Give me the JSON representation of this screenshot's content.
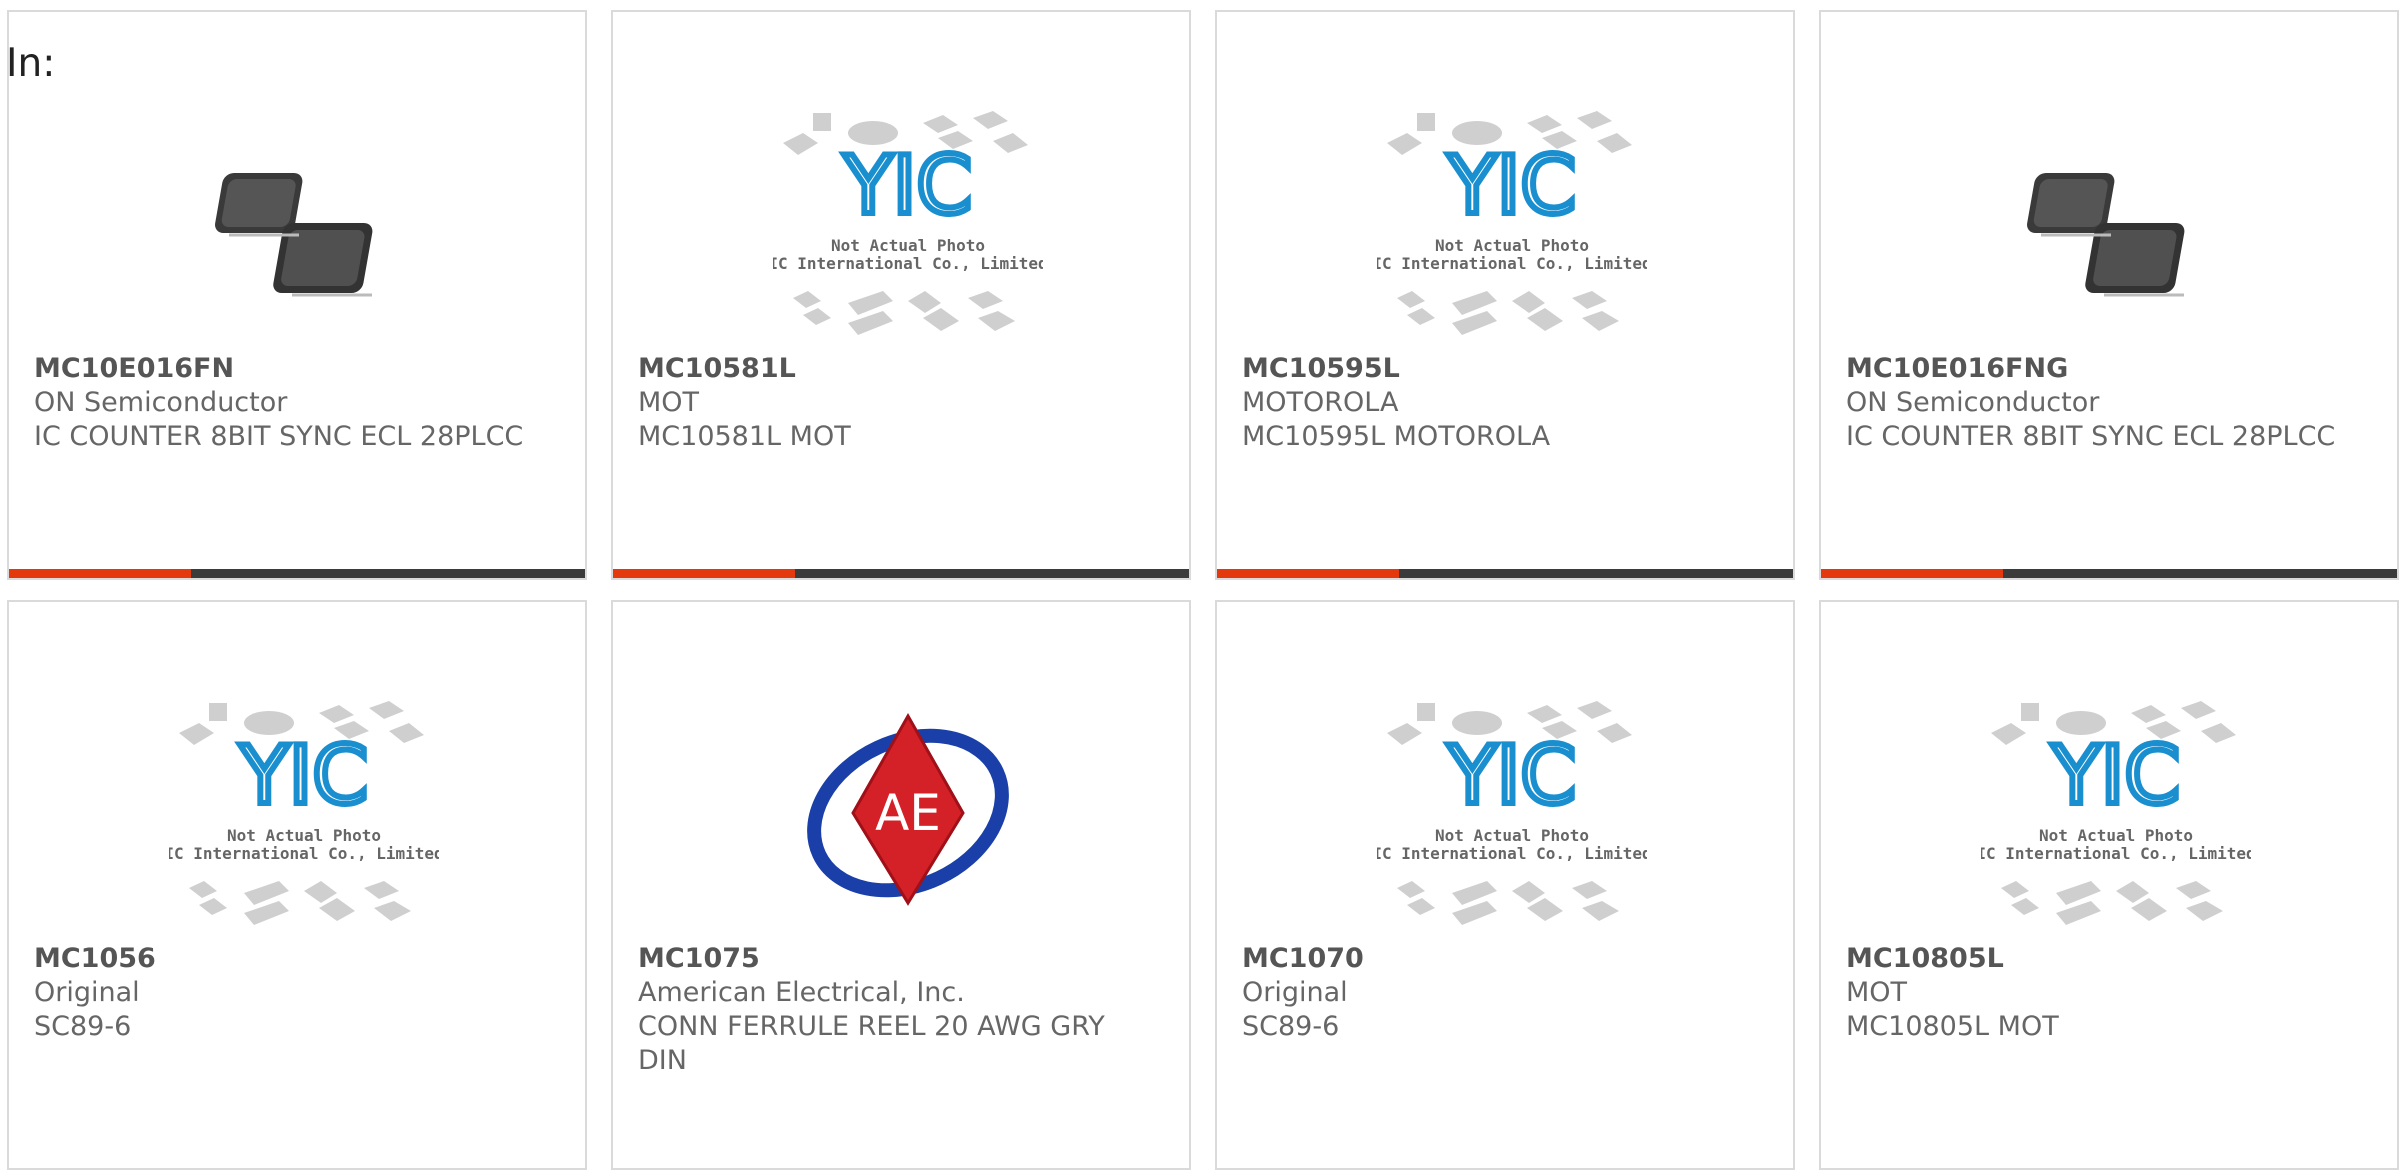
{
  "heading": "In:",
  "colors": {
    "accent": "#e4380d",
    "bar_dark": "#3b3b3b",
    "card_border": "#dadada",
    "text": "#666666",
    "yic_blue": "#1a8fd0"
  },
  "placeholder_caption": {
    "line1": "Not Actual Photo",
    "line2": "YIC International Co., Limited."
  },
  "products": [
    {
      "part": "MC10E016FN",
      "manufacturer": "ON Semiconductor",
      "description": "IC COUNTER 8BIT SYNC ECL 28PLCC",
      "image": "plcc-chip-photo"
    },
    {
      "part": "MC10581L",
      "manufacturer": "MOT",
      "description": "MC10581L MOT",
      "image": "yic-placeholder"
    },
    {
      "part": "MC10595L",
      "manufacturer": "MOTOROLA",
      "description": "MC10595L MOTOROLA",
      "image": "yic-placeholder"
    },
    {
      "part": "MC10E016FNG",
      "manufacturer": "ON Semiconductor",
      "description": "IC COUNTER 8BIT SYNC ECL 28PLCC",
      "image": "plcc-chip-photo"
    },
    {
      "part": "MC1056",
      "manufacturer": "Original",
      "description": "SC89-6",
      "image": "yic-placeholder"
    },
    {
      "part": "MC1075",
      "manufacturer": "American Electrical, Inc.",
      "description": "CONN FERRULE REEL 20 AWG GRY DIN",
      "image": "ae-logo",
      "logo_text": "AE"
    },
    {
      "part": "MC1070",
      "manufacturer": "Original",
      "description": "SC89-6",
      "image": "yic-placeholder"
    },
    {
      "part": "MC10805L",
      "manufacturer": "MOT",
      "description": "MC10805L MOT",
      "image": "yic-placeholder"
    }
  ]
}
